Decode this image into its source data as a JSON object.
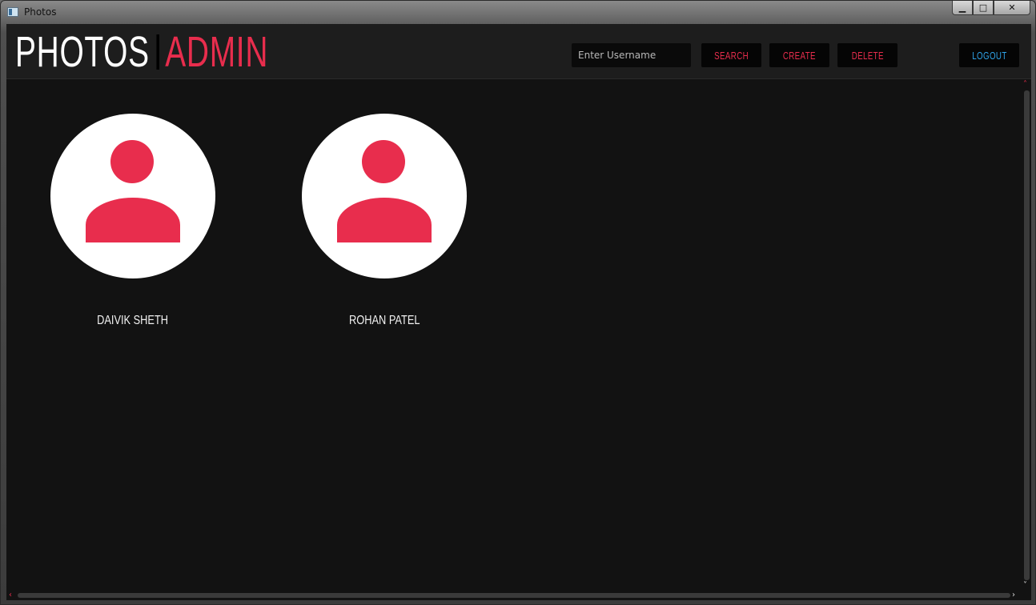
{
  "window": {
    "title": "Photos",
    "controls": {
      "minimize": "▁",
      "maximize": "□",
      "close": "✕"
    }
  },
  "header": {
    "logo_primary": "PHOTOS",
    "logo_secondary": "ADMIN",
    "search_placeholder": "Enter Username",
    "search_value": "",
    "buttons": {
      "search": "SEARCH",
      "create": "CREATE",
      "delete": "DELETE",
      "logout": "LOGOUT"
    }
  },
  "users": [
    {
      "name": "DAIVIK SHETH",
      "icon": "user-avatar-icon"
    },
    {
      "name": "ROHAN PATEL",
      "icon": "user-avatar-icon"
    }
  ],
  "scrollbars": {
    "up": "˄",
    "down": "˅",
    "left": "‹",
    "right": "›"
  },
  "colors": {
    "accent": "#e82d4d",
    "logout": "#2fa3e8",
    "background": "#121212",
    "header": "#1d1d1d"
  }
}
